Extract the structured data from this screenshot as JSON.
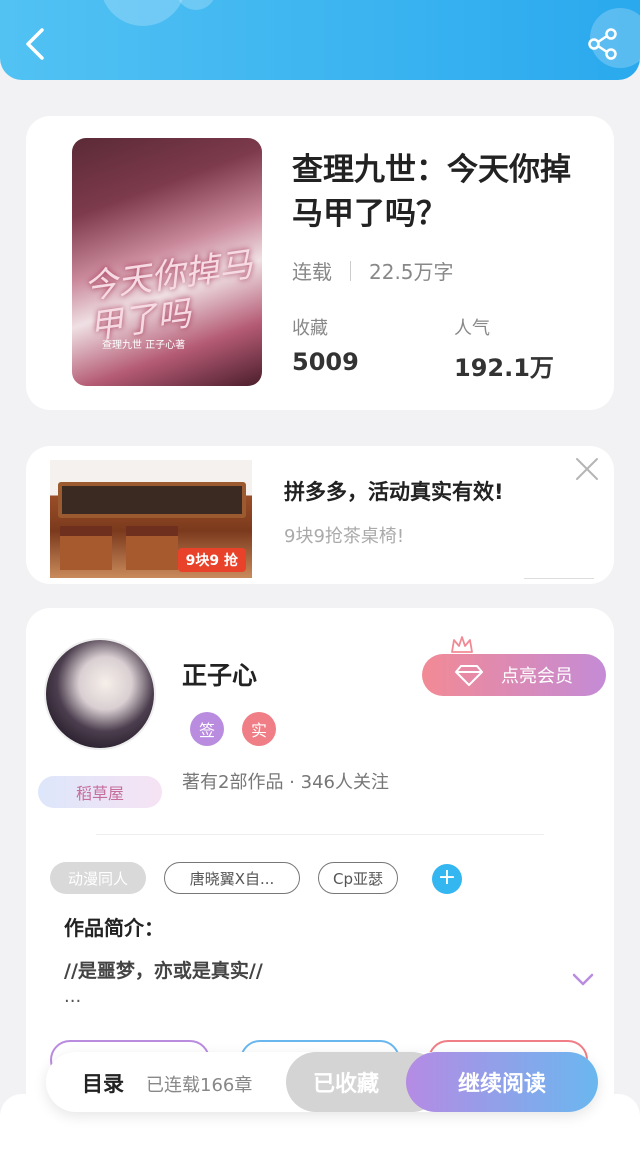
{
  "colors": {
    "header": "#2aa9ee",
    "accent_blue": "#34b6f0",
    "vip_start": "#f28a95",
    "vip_end": "#c48bd6",
    "badge_sign": "#b98ce0",
    "badge_real": "#f07e86"
  },
  "header": {
    "back_icon": "chevron-left-icon",
    "share_icon": "share-icon"
  },
  "book": {
    "cover_title": "今天你掉马甲了吗",
    "cover_subtitle": "查理九世 正子心著",
    "title": "查理九世：今天你掉马甲了吗？",
    "status": "连载",
    "word_count": "22.5万字",
    "collect_label": "收藏",
    "collect_value": "5009",
    "popularity_label": "人气",
    "popularity_value": "192.1万"
  },
  "ad": {
    "badge": "9块9 抢",
    "title": "拼多多，活动真实有效!",
    "subtitle": "9块9抢茶桌椅!"
  },
  "author": {
    "name": "正子心",
    "house_tag": "稻草屋",
    "badge_sign": "签",
    "badge_real": "实",
    "vip_button": "点亮会员",
    "meta": "著有2部作品 · 346人关注",
    "tags": [
      "动漫同人",
      "唐晓翼X自...",
      "Cp亚瑟"
    ],
    "intro_heading": "作品简介：",
    "intro_text": "//是噩梦，亦或是真实//",
    "intro_ellipsis": "..."
  },
  "read_bar": {
    "toc_label": "目录",
    "chapter_count": "已连载166章",
    "favorited_label": "已收藏",
    "continue_label": "继续阅读"
  }
}
